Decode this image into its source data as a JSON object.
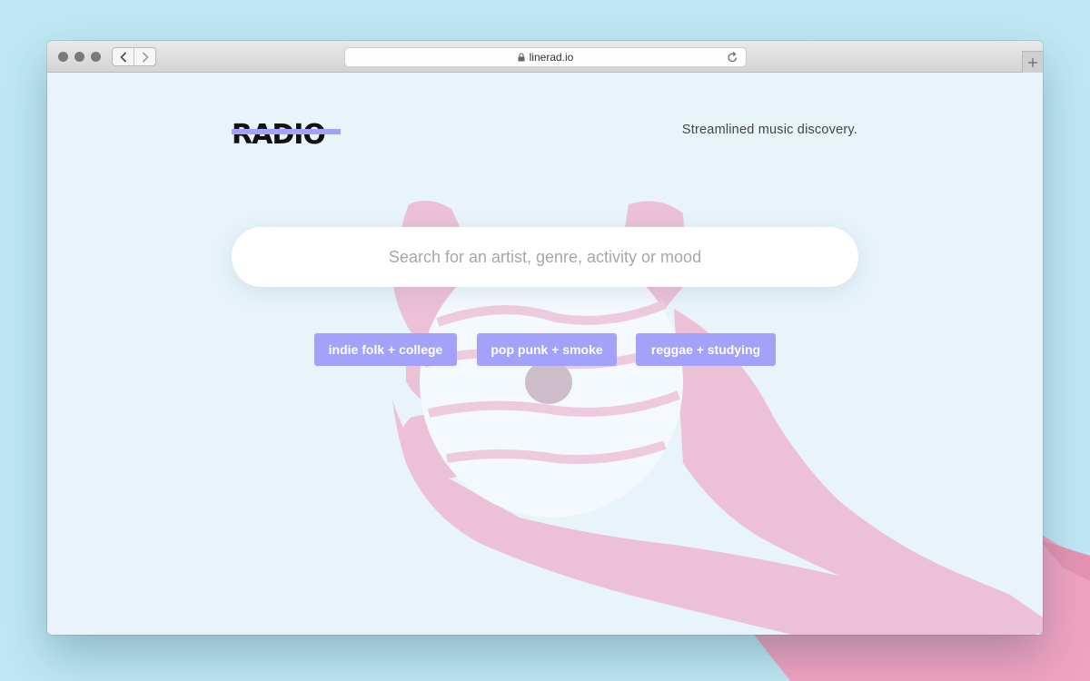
{
  "browser": {
    "url": "linerad.io"
  },
  "page": {
    "logo_text": "RADIO",
    "tagline": "Streamlined music discovery.",
    "search": {
      "placeholder": "Search for an artist, genre, activity or mood",
      "value": ""
    },
    "chips": [
      {
        "label": "indie folk + college"
      },
      {
        "label": "pop punk + smoke"
      },
      {
        "label": "reggae + studying"
      }
    ]
  },
  "colors": {
    "desktop": "#bfe8f4",
    "page_bg": "#e8f4fa",
    "accent": "#a4a1fb",
    "glove": "#f2a9c3"
  },
  "icons": [
    "back-arrow-icon",
    "forward-arrow-icon",
    "lock-icon",
    "reload-icon",
    "plus-icon"
  ]
}
